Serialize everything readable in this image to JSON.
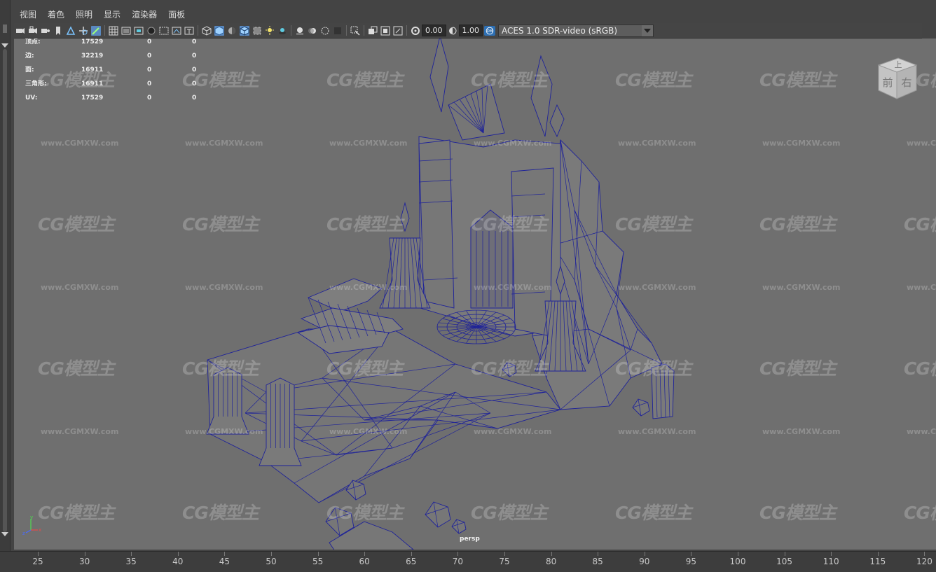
{
  "menubar": {
    "items": [
      "视图",
      "着色",
      "照明",
      "显示",
      "渲染器",
      "面板"
    ]
  },
  "toolbar": {
    "exposure_value": "0.00",
    "gamma_value": "1.00",
    "colorspace_badge": "OM",
    "colorspace": "ACES 1.0 SDR-video (sRGB)"
  },
  "hud": {
    "rows": [
      {
        "label": "顶点:",
        "value": "17529",
        "c2": "0",
        "c3": "0"
      },
      {
        "label": "边:",
        "value": "32219",
        "c2": "0",
        "c3": "0"
      },
      {
        "label": "面:",
        "value": "16911",
        "c2": "0",
        "c3": "0"
      },
      {
        "label": "三角形:",
        "value": "16911",
        "c2": "0",
        "c3": "0"
      },
      {
        "label": "UV:",
        "value": "17529",
        "c2": "0",
        "c3": "0"
      }
    ]
  },
  "viewcube": {
    "top_label": "上",
    "front_label": "前",
    "right_label": "右"
  },
  "axes": {
    "x": "x",
    "y": "y",
    "z": "z"
  },
  "camera_label": "persp",
  "watermark": {
    "logo": "CG模型主",
    "url": "www.CGMXW.com"
  },
  "timeline": {
    "ticks": [
      "25",
      "30",
      "35",
      "40",
      "45",
      "50",
      "55",
      "60",
      "65",
      "70",
      "75",
      "80",
      "85",
      "90",
      "95",
      "100",
      "105",
      "110",
      "115",
      "120"
    ]
  },
  "colors": {
    "wire": "#1e2299",
    "viewport_bg": "#6f6f6f",
    "accent": "#5a89c0"
  }
}
